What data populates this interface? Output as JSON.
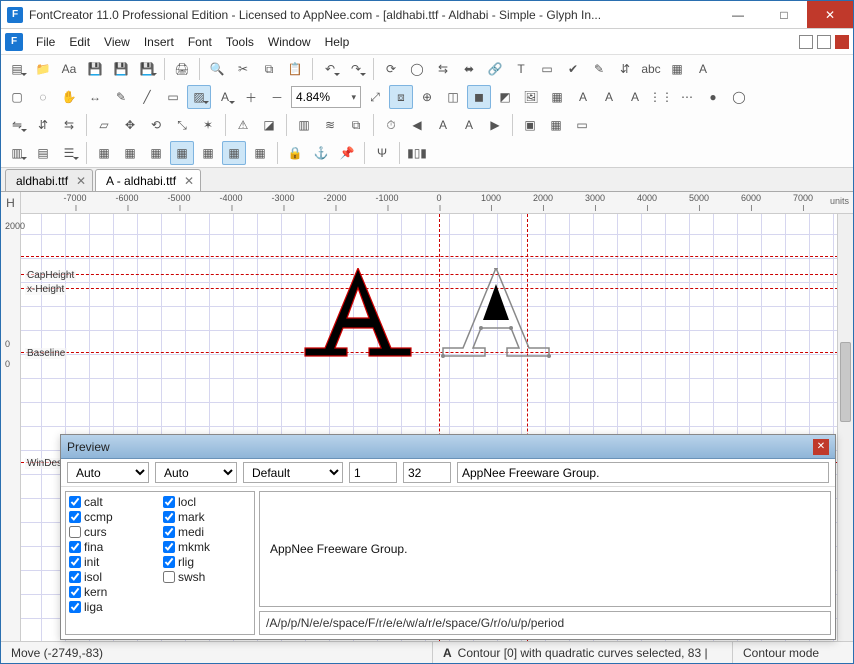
{
  "window": {
    "title": "FontCreator 11.0 Professional Edition - Licensed to AppNee.com - [aldhabi.ttf - Aldhabi - Simple - Glyph In...",
    "app_abbrev": "F"
  },
  "menu": {
    "items": [
      "File",
      "Edit",
      "View",
      "Insert",
      "Font",
      "Tools",
      "Window",
      "Help"
    ]
  },
  "toolbar": {
    "zoom_value": "4.84%"
  },
  "tabs": [
    {
      "label": "aldhabi.ttf",
      "active": false
    },
    {
      "label": "A - aldhabi.ttf",
      "active": true
    }
  ],
  "ruler": {
    "corner": "H",
    "units_label": "units",
    "h_ticks": [
      "-7000",
      "-6000",
      "-5000",
      "-4000",
      "-3000",
      "-2000",
      "-1000",
      "0",
      "1000",
      "2000",
      "3000",
      "4000",
      "5000",
      "6000",
      "7000"
    ],
    "v_ticks": [
      "2000",
      "0",
      "0"
    ]
  },
  "guides": {
    "capheight": "CapHeight",
    "xheight": "x-Height",
    "baseline": "Baseline",
    "windescent": "WinDes"
  },
  "preview": {
    "title": "Preview",
    "combo1": "Auto",
    "combo2": "Auto",
    "combo3": "Default",
    "num1": "1",
    "num2": "32",
    "sample_text_input": "AppNee Freeware Group.",
    "render_text": "AppNee Freeware Group.",
    "readout": "/A/p/p/N/e/e/space/F/r/e/e/w/a/r/e/space/G/r/o/u/p/period",
    "features": [
      {
        "name": "calt",
        "on": true
      },
      {
        "name": "locl",
        "on": true
      },
      {
        "name": "ccmp",
        "on": true
      },
      {
        "name": "mark",
        "on": true
      },
      {
        "name": "curs",
        "on": false
      },
      {
        "name": "medi",
        "on": true
      },
      {
        "name": "fina",
        "on": true
      },
      {
        "name": "mkmk",
        "on": true
      },
      {
        "name": "init",
        "on": true
      },
      {
        "name": "rlig",
        "on": true
      },
      {
        "name": "isol",
        "on": true
      },
      {
        "name": "swsh",
        "on": false
      },
      {
        "name": "kern",
        "on": true
      },
      {
        "name": "",
        "on": null
      },
      {
        "name": "liga",
        "on": true
      },
      {
        "name": "",
        "on": null
      }
    ]
  },
  "status": {
    "left": "Move (-2749,-83)",
    "mid_icon": "A",
    "mid": "Contour [0] with quadratic curves selected, 83 |",
    "right": "Contour mode"
  },
  "icons": {
    "row1": [
      "file-new",
      "folder-open",
      "font-aa",
      "save",
      "save-all",
      "save-as",
      "sep",
      "print",
      "sep",
      "find",
      "cut",
      "copy",
      "paste",
      "sep",
      "undo",
      "redo",
      "sep",
      "refresh",
      "circle-arrow",
      "flip",
      "horz",
      "link",
      "text-box",
      "page",
      "check",
      "edit",
      "swap",
      "tag",
      "color-swatch",
      "a-color"
    ],
    "row2": [
      "select-dotted",
      "lasso",
      "hand",
      "measure",
      "pen",
      "line",
      "rect",
      "fill",
      "a-outline",
      "zoom-in",
      "zoom-out",
      "zoombox",
      "fit",
      "bounds",
      "target",
      "pick",
      "dark",
      "slice",
      "image",
      "guides",
      "a-shape",
      "a-left",
      "a-right",
      "grid-dots",
      "grid-dots2",
      "circle",
      "ring"
    ],
    "row3": [
      "flip-h",
      "flip-v",
      "mirror",
      "sep",
      "skew",
      "move",
      "rotate",
      "scale",
      "art",
      "sep",
      "alert",
      "eraser",
      "sep",
      "bars",
      "barwave",
      "compare",
      "sep",
      "time",
      "arrow-l",
      "a-l",
      "a-r",
      "arrow-r",
      "sep",
      "stack",
      "layers",
      "back"
    ],
    "row4": [
      "panel",
      "panel2",
      "tree",
      "sep",
      "grid1",
      "grid2",
      "grid3",
      "grid4",
      "grid5",
      "grid6",
      "grid7",
      "sep",
      "lock",
      "anchor",
      "pin",
      "sep",
      "branch",
      "sep",
      "barcode"
    ]
  }
}
